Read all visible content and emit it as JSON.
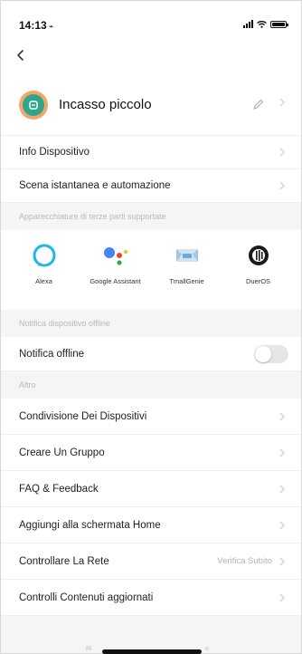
{
  "status_bar": {
    "time": "14:13",
    "location_glyph": "⌁"
  },
  "nav": {
    "back_icon": "chevron-left-icon"
  },
  "device": {
    "name": "Incasso piccolo",
    "avatar_color": "#f2a66b",
    "icon_color": "#2fa58a"
  },
  "rows_top": [
    {
      "label": "Info Dispositivo"
    },
    {
      "label": "Scena istantanea e automazione"
    }
  ],
  "section_third_party": "Apparecchiature di terze parti supportate",
  "assistants": [
    {
      "name": "Alexa",
      "icon": "alexa-icon"
    },
    {
      "name": "Google Assistant",
      "icon": "google-assistant-icon"
    },
    {
      "name": "TmallGenie",
      "icon": "tmallgenie-icon"
    },
    {
      "name": "DuerOS",
      "icon": "dueros-icon"
    }
  ],
  "section_offline": "Notifica dispositivo offline",
  "offline_row": {
    "label": "Notifica offline",
    "toggle_on": false
  },
  "section_other": "Altro",
  "rows_other": [
    {
      "label": "Condivisione Dei Dispositivi"
    },
    {
      "label": "Creare Un Gruppo"
    },
    {
      "label": "FAQ & Feedback"
    },
    {
      "label": "Aggiungi alla schermata Home"
    },
    {
      "label": "Controllare La Rete",
      "value": "Verifica Subito"
    },
    {
      "label": "Controlli Contenuti aggiornati"
    }
  ],
  "footer": {
    "left": "Ri",
    "right": "o"
  }
}
